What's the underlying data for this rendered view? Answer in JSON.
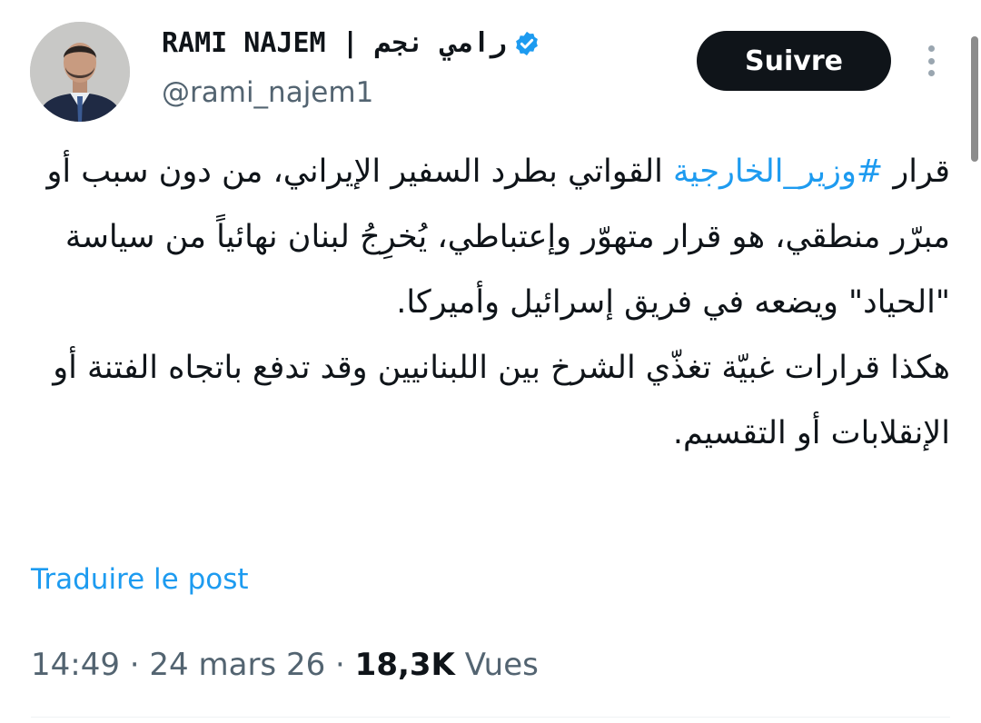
{
  "author": {
    "display_name": "RAMI NAJEM | رامي نجم",
    "handle": "@rami_najem1",
    "verified_icon": "verified-badge-icon",
    "avatar_icon": "profile-photo"
  },
  "actions": {
    "follow_label": "Suivre",
    "more_icon": "more-options-icon"
  },
  "tweet": {
    "line1_prefix": "قرار ",
    "hashtag": "#وزير_الخارجية",
    "line1_suffix": " القواتي بطرد السفير الإيراني، من دون سبب أو مبرّر منطقي، هو قرار متهوّر وإعتباطي، يُخرِجُ لبنان نهائياً من سياسة \"الحياد\" ويضعه في فريق إسرائيل وأميركا.",
    "paragraph2": "هكذا قرارات غبيّة تغذّي الشرخ بين اللبنانيين وقد تدفع باتجاه الفتنة أو الإنقلابات أو التقسيم."
  },
  "translate_label": "Traduire le post",
  "meta": {
    "time": "14:49",
    "separator": " · ",
    "date": "24 mars 26",
    "views_count": "18,3K",
    "views_label": " Vues"
  },
  "colors": {
    "accent": "#1d9bf0",
    "text": "#0f1419",
    "muted": "#536471",
    "button_bg": "#0f1419"
  }
}
